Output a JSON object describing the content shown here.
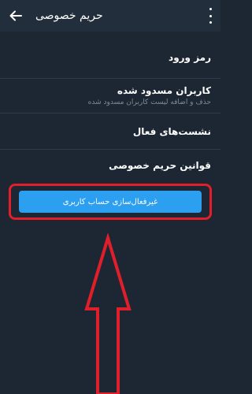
{
  "header": {
    "title": "حریم خصوصی",
    "back_icon": "arrow-left-icon",
    "menu_icon": "more-vertical-icon"
  },
  "items": [
    {
      "label": "رمز ورود"
    },
    {
      "label": "کاربران مسدود شده",
      "subtitle": "حذف و اضافه لیست کاربران مسدود شده"
    },
    {
      "label": "نشست‌های فعال"
    },
    {
      "label": "قوانین حریم خصوصی"
    }
  ],
  "action_button": {
    "label": "غیرفعال‌سازی حساب کاربری"
  },
  "colors": {
    "background": "#1d2733",
    "header": "#232e3c",
    "button": "#2c9ff0",
    "highlight": "#e01f2a"
  }
}
